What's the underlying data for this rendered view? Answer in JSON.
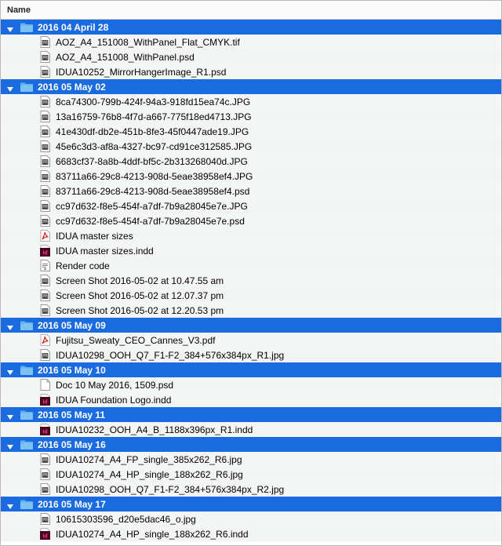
{
  "header": {
    "name_label": "Name"
  },
  "groups": [
    {
      "title": "2016 04 April 28",
      "files": [
        {
          "name": "AOZ_A4_151008_WithPanel_Flat_CMYK.tif",
          "icon": "image-file-icon"
        },
        {
          "name": "AOZ_A4_151008_WithPanel.psd",
          "icon": "image-file-icon"
        },
        {
          "name": "IDUA10252_MirrorHangerImage_R1.psd",
          "icon": "image-file-icon"
        }
      ]
    },
    {
      "title": "2016 05 May 02",
      "files": [
        {
          "name": "8ca74300-799b-424f-94a3-918fd15ea74c.JPG",
          "icon": "image-file-icon"
        },
        {
          "name": "13a16759-76b8-4f7d-a667-775f18ed4713.JPG",
          "icon": "image-file-icon"
        },
        {
          "name": "41e430df-db2e-451b-8fe3-45f0447ade19.JPG",
          "icon": "image-file-icon"
        },
        {
          "name": "45e6c3d3-af8a-4327-bc97-cd91ce312585.JPG",
          "icon": "image-file-icon"
        },
        {
          "name": "6683cf37-8a8b-4ddf-bf5c-2b313268040d.JPG",
          "icon": "image-file-icon"
        },
        {
          "name": "83711a66-29c8-4213-908d-5eae38958ef4.JPG",
          "icon": "image-file-icon"
        },
        {
          "name": "83711a66-29c8-4213-908d-5eae38958ef4.psd",
          "icon": "image-file-icon"
        },
        {
          "name": "cc97d632-f8e5-454f-a7df-7b9a28045e7e.JPG",
          "icon": "image-file-icon"
        },
        {
          "name": "cc97d632-f8e5-454f-a7df-7b9a28045e7e.psd",
          "icon": "image-file-icon"
        },
        {
          "name": "IDUA master sizes",
          "icon": "pdf-file-icon"
        },
        {
          "name": "IDUA master sizes.indd",
          "icon": "indesign-file-icon"
        },
        {
          "name": "Render code",
          "icon": "text-file-icon"
        },
        {
          "name": "Screen Shot 2016-05-02 at 10.47.55 am",
          "icon": "image-file-icon"
        },
        {
          "name": "Screen Shot 2016-05-02 at 12.07.37 pm",
          "icon": "image-file-icon"
        },
        {
          "name": "Screen Shot 2016-05-02 at 12.20.53 pm",
          "icon": "image-file-icon"
        }
      ]
    },
    {
      "title": "2016 05 May 09",
      "files": [
        {
          "name": "Fujitsu_Sweaty_CEO_Cannes_V3.pdf",
          "icon": "pdf-file-icon"
        },
        {
          "name": "IDUA10298_OOH_Q7_F1-F2_384+576x384px_R1.jpg",
          "icon": "image-file-icon"
        }
      ]
    },
    {
      "title": "2016 05 May 10",
      "files": [
        {
          "name": "Doc 10 May 2016, 1509.psd",
          "icon": "blank-file-icon"
        },
        {
          "name": "IDUA Foundation Logo.indd",
          "icon": "indesign-file-icon"
        }
      ]
    },
    {
      "title": "2016 05 May 11",
      "files": [
        {
          "name": "IDUA10232_OOH_A4_B_1188x396px_R1.indd",
          "icon": "indesign-file-icon"
        }
      ]
    },
    {
      "title": "2016 05 May 16",
      "files": [
        {
          "name": "IDUA10274_A4_FP_single_385x262_R6.jpg",
          "icon": "image-file-icon"
        },
        {
          "name": "IDUA10274_A4_HP_single_188x262_R6.jpg",
          "icon": "image-file-icon"
        },
        {
          "name": "IDUA10298_OOH_Q7_F1-F2_384+576x384px_R2.jpg",
          "icon": "image-file-icon"
        }
      ]
    },
    {
      "title": "2016 05 May 17",
      "files": [
        {
          "name": "10615303596_d20e5dac46_o.jpg",
          "icon": "image-file-icon"
        },
        {
          "name": "IDUA10274_A4_HP_single_188x262_R6.indd",
          "icon": "indesign-file-icon"
        }
      ]
    }
  ],
  "colors": {
    "selection": "#1a6be0",
    "folder": "#5eb2ef",
    "indesign": "#49021f",
    "indesign_text": "#ff3e8a",
    "pdf": "#d7241b"
  }
}
